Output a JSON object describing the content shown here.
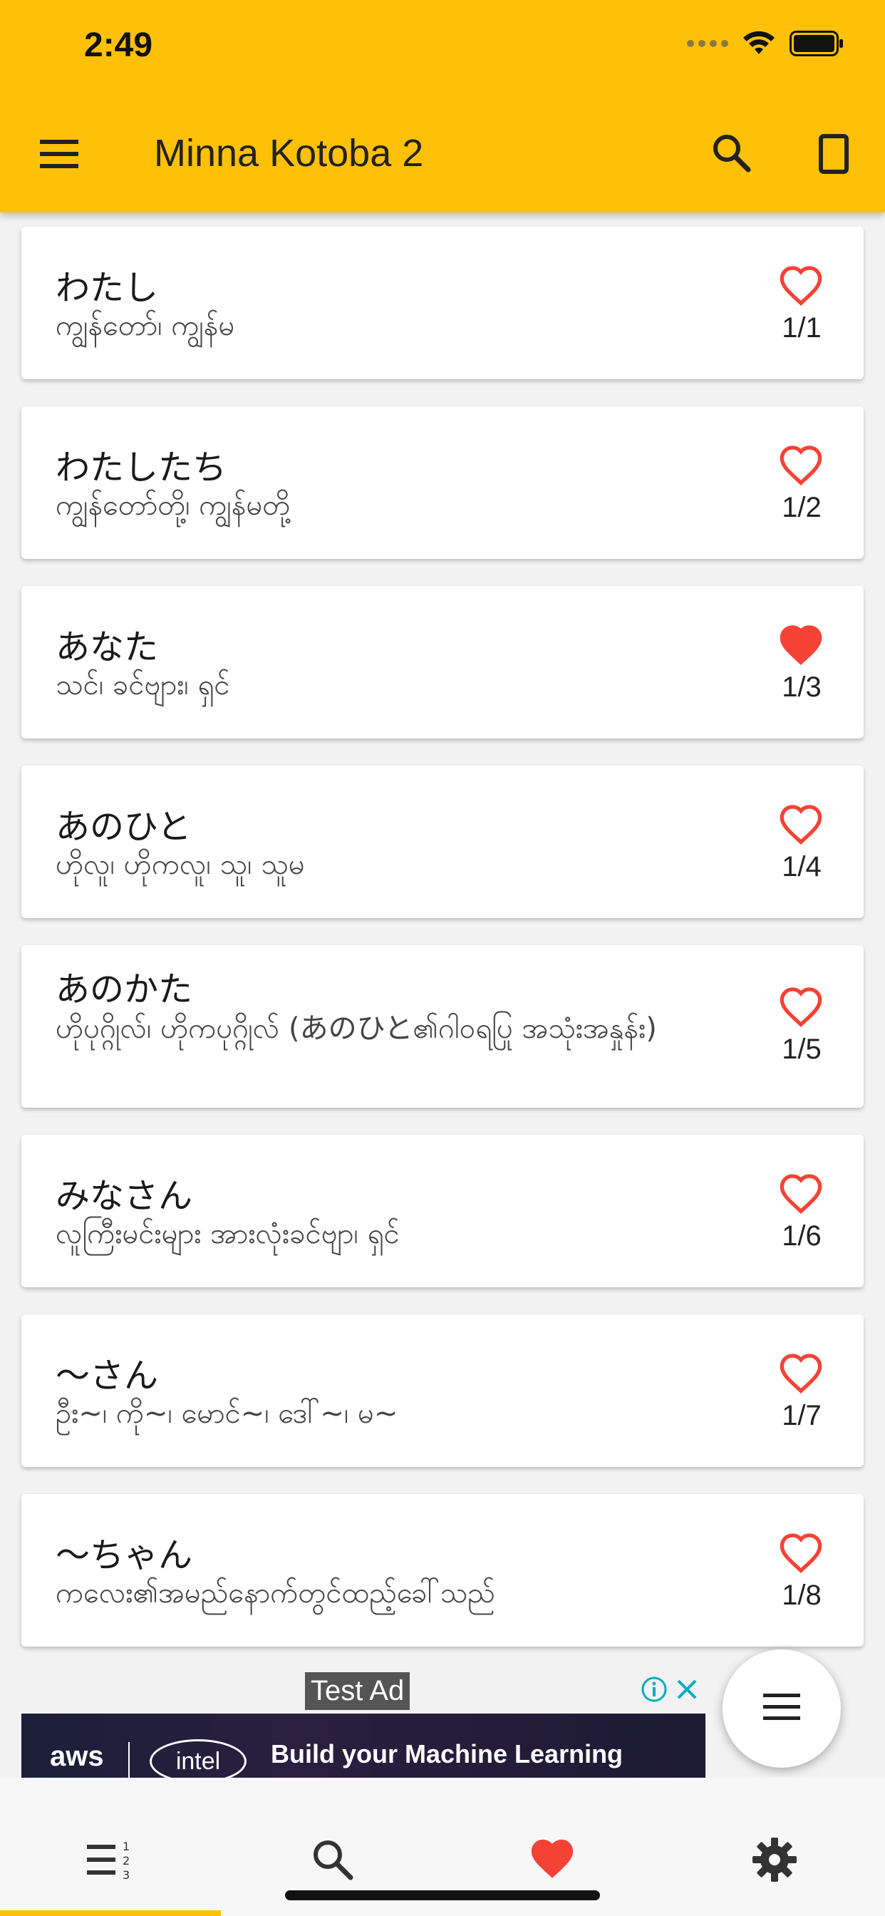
{
  "status_bar": {
    "time": "2:49"
  },
  "toolbar": {
    "title": "Minna Kotoba 2"
  },
  "words": [
    {
      "japanese": "わたし",
      "meaning": "ကျွန်တော်၊ ကျွန်မ",
      "number": "1/1",
      "favorite": false
    },
    {
      "japanese": "わたしたち",
      "meaning": "ကျွန်တော်တို့၊ ကျွန်မတို့",
      "number": "1/2",
      "favorite": false
    },
    {
      "japanese": "あなた",
      "meaning": "သင်၊ ခင်ဗျား၊ ရှင်",
      "number": "1/3",
      "favorite": true
    },
    {
      "japanese": "あのひと",
      "meaning": "ဟိုလူ၊ ဟိုကလူ၊ သူ၊ သူမ",
      "number": "1/4",
      "favorite": false
    },
    {
      "japanese": "あのかた",
      "meaning": "ဟိုပုဂ္ဂိုလ်၊ ဟိုကပုဂ္ဂိုလ် (あのひと၏ဂါ၀ရပြု အသုံးအနှုန်း)",
      "number": "1/5",
      "favorite": false
    },
    {
      "japanese": "みなさん",
      "meaning": "လူကြီးမင်းများ အားလုံးခင်ဗျာ၊ ရှင်",
      "number": "1/6",
      "favorite": false
    },
    {
      "japanese": "～さん",
      "meaning": "ဦး~၊ ကို~၊ မောင်~၊ ဒေါ်~၊ မ~",
      "number": "1/7",
      "favorite": false
    },
    {
      "japanese": "～ちゃん",
      "meaning": "ကလေး၏အမည်နောက်တွင်ထည့်ခေါ်သည်",
      "number": "1/8",
      "favorite": false
    }
  ],
  "ad": {
    "label": "Test Ad",
    "aws": "aws",
    "intel": "intel",
    "text": "Build your Machine Learning"
  },
  "colors": {
    "accent": "#FFC107",
    "heart": "#F44336"
  }
}
